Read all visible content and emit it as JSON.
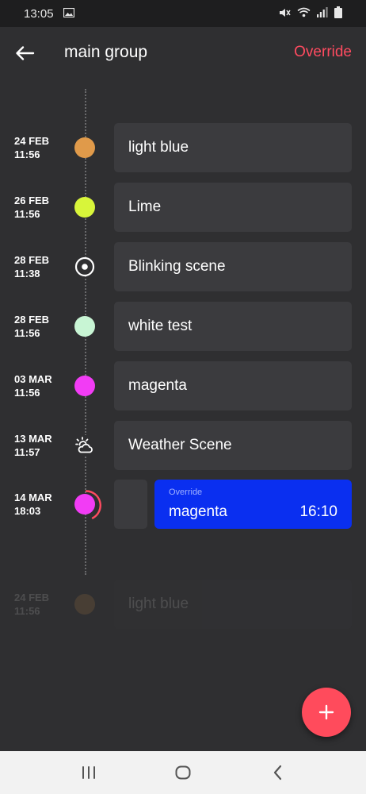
{
  "status_bar": {
    "time": "13:05",
    "icons": [
      "image-icon",
      "mute-icon",
      "wifi-icon",
      "signal-icon",
      "battery-icon"
    ]
  },
  "app_bar": {
    "back_icon": "arrow-left-icon",
    "title": "main group",
    "action_label": "Override",
    "action_color": "#ff4b60"
  },
  "timeline": [
    {
      "date": "24 FEB",
      "time": "11:56",
      "marker": "dot",
      "color": "#e09a4a",
      "label": "light blue"
    },
    {
      "date": "26 FEB",
      "time": "11:56",
      "marker": "dot",
      "color": "#d8f53a",
      "label": "Lime"
    },
    {
      "date": "28 FEB",
      "time": "11:38",
      "marker": "blink-icon",
      "color": "#ffffff",
      "label": "Blinking scene"
    },
    {
      "date": "28 FEB",
      "time": "11:56",
      "marker": "dot",
      "color": "#c8f5d4",
      "label": "white test"
    },
    {
      "date": "03 MAR",
      "time": "11:56",
      "marker": "dot",
      "color": "#f23cf5",
      "label": "magenta"
    },
    {
      "date": "13 MAR",
      "time": "11:57",
      "marker": "weather-icon",
      "color": "#ffffff",
      "label": "Weather Scene"
    }
  ],
  "active_entry": {
    "date": "14 MAR",
    "time": "18:03",
    "color": "#f23cf5",
    "progress_color": "#ff4b60",
    "kind": "Override",
    "label": "magenta",
    "clock": "16:10",
    "card_color": "#0a2ff0"
  },
  "upcoming_entry": {
    "date": "24 FEB",
    "time": "11:56",
    "color": "#e09a4a",
    "label": "light blue"
  },
  "fab": {
    "icon": "plus-icon",
    "color": "#ff4b5c"
  },
  "nav_bar": {
    "icons": [
      "recent-apps-icon",
      "home-icon",
      "back-nav-icon"
    ]
  }
}
